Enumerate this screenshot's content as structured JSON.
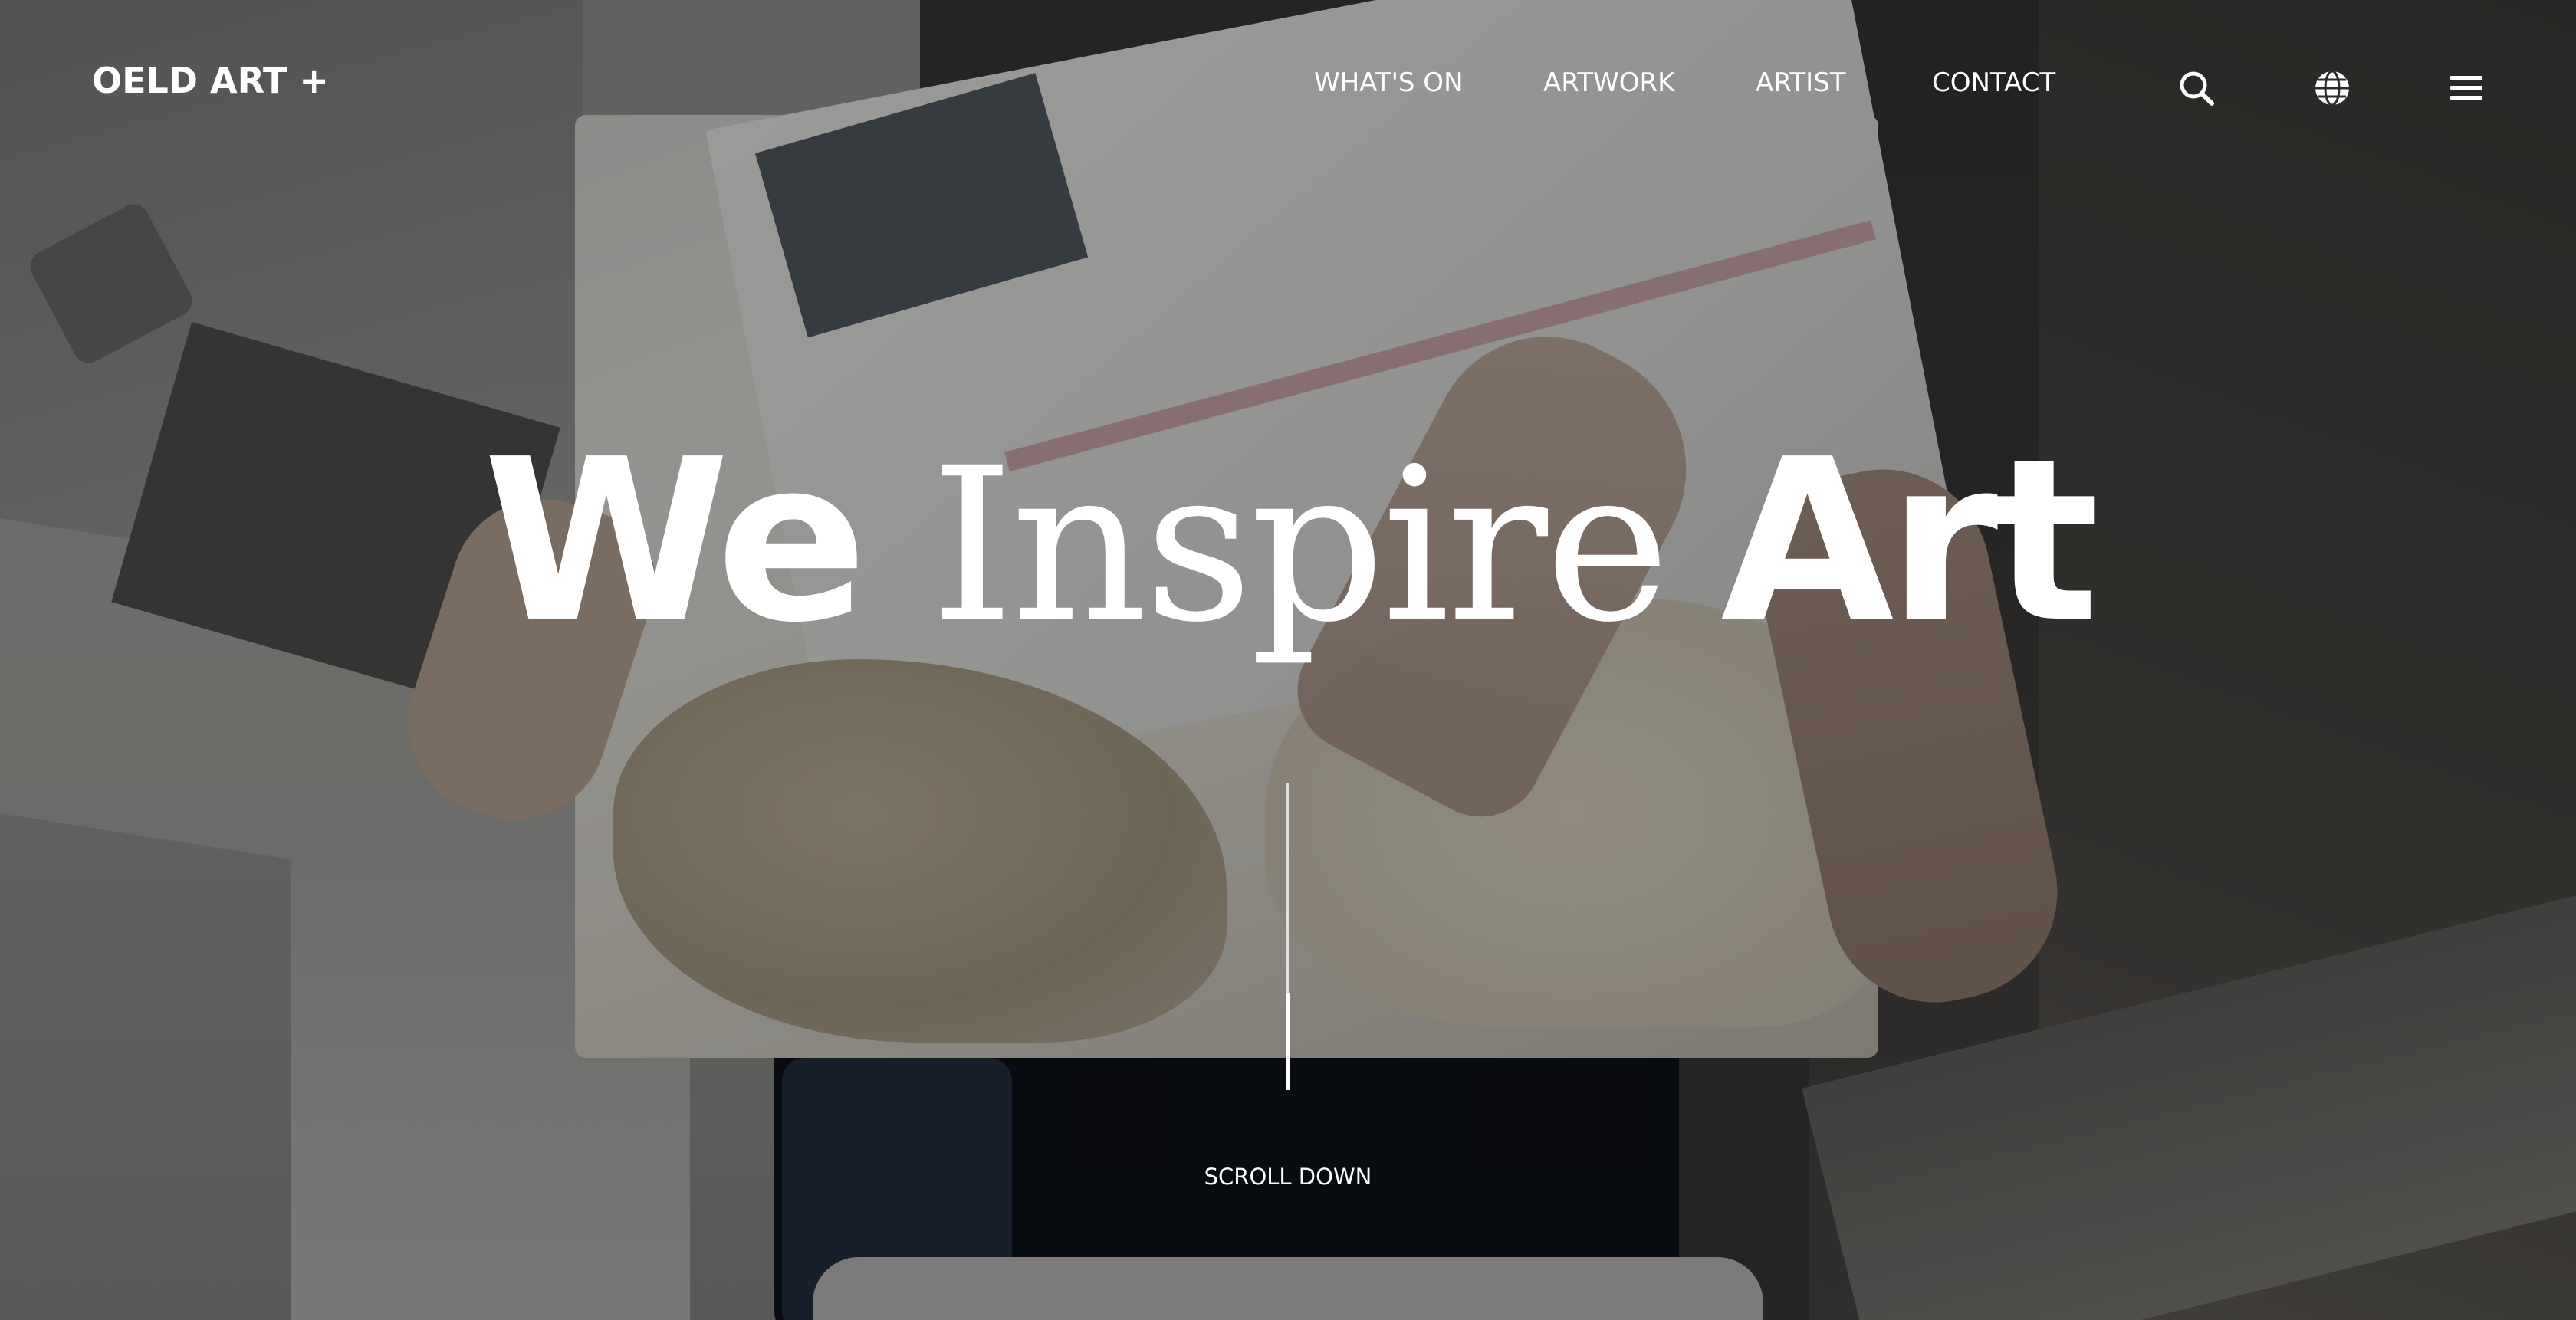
{
  "header": {
    "logo": "OELD ART +",
    "nav": [
      {
        "label": "WHAT'S ON"
      },
      {
        "label": "ARTWORK"
      },
      {
        "label": "ARTIST"
      },
      {
        "label": "CONTACT"
      }
    ],
    "icons": [
      "search-icon",
      "globe-icon",
      "menu-icon"
    ]
  },
  "hero": {
    "headline_word_1": "We",
    "headline_word_2": "Inspire",
    "headline_word_3": "Art",
    "scroll_label": "SCROLL DOWN",
    "background_image_subject": "hands holding an open art magazine"
  },
  "colors": {
    "text": "#ffffff",
    "overlay": "#000000"
  }
}
